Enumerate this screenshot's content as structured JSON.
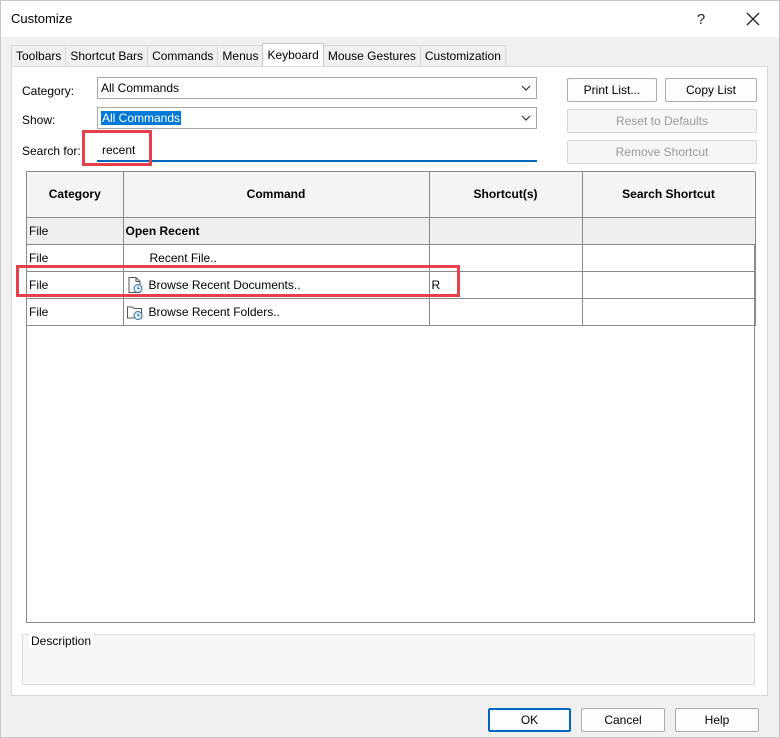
{
  "window": {
    "title": "Customize",
    "help_label": "?"
  },
  "tabs": [
    {
      "label": "Toolbars"
    },
    {
      "label": "Shortcut Bars"
    },
    {
      "label": "Commands"
    },
    {
      "label": "Menus"
    },
    {
      "label": "Keyboard",
      "active": true
    },
    {
      "label": "Mouse Gestures"
    },
    {
      "label": "Customization"
    }
  ],
  "form": {
    "category_label": "Category:",
    "category_value": "All Commands",
    "show_label": "Show:",
    "show_value": "All Commands",
    "search_label": "Search for:",
    "search_value": "recent"
  },
  "buttons": {
    "print_list": "Print List...",
    "copy_list": "Copy List",
    "reset_defaults": "Reset to Defaults",
    "remove_shortcut": "Remove Shortcut"
  },
  "table": {
    "headers": [
      "Category",
      "Command",
      "Shortcut(s)",
      "Search Shortcut"
    ],
    "rows": [
      {
        "category": "File",
        "command": "Open Recent",
        "shortcut": "",
        "search": "",
        "group": true,
        "icon": ""
      },
      {
        "category": "File",
        "command": "Recent File..",
        "shortcut": "",
        "search": "",
        "group": false,
        "icon": ""
      },
      {
        "category": "File",
        "command": "Browse Recent Documents..",
        "shortcut": "R",
        "search": "",
        "group": false,
        "icon": "document-clock-icon"
      },
      {
        "category": "File",
        "command": "Browse Recent Folders..",
        "shortcut": "",
        "search": "",
        "group": false,
        "icon": "folder-clock-icon"
      }
    ]
  },
  "description": {
    "label": "Description"
  },
  "footer": {
    "ok": "OK",
    "cancel": "Cancel",
    "help": "Help"
  },
  "colors": {
    "highlight": "#e8404a",
    "accent": "#0078d7"
  }
}
